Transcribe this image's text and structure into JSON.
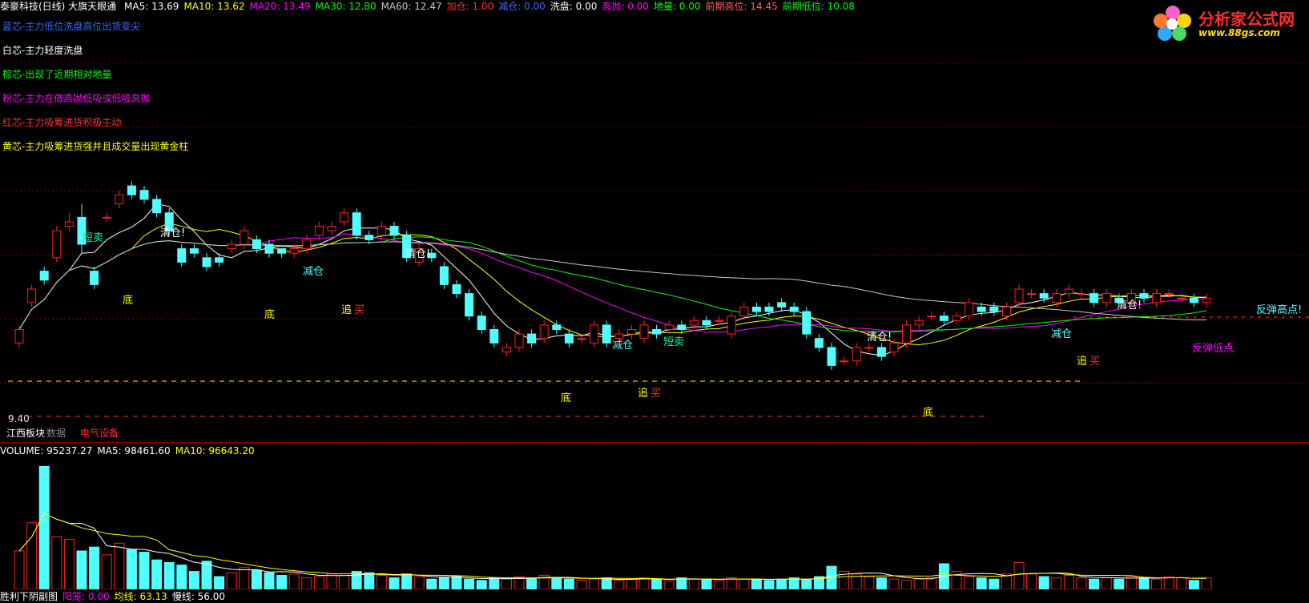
{
  "header": {
    "title": "泰豪科技(日线) 大旗天眼通",
    "items": [
      {
        "text": "MA5: 13.69",
        "color": "#ffffff"
      },
      {
        "text": "MA10: 13.62",
        "color": "#ffff00"
      },
      {
        "text": "MA20: 13.49",
        "color": "#ff00ff"
      },
      {
        "text": "MA30: 12.80",
        "color": "#00ff00"
      },
      {
        "text": "MA60: 12.47",
        "color": "#c8c8c8"
      },
      {
        "text": "加仓: 1.00",
        "color": "#ff3030"
      },
      {
        "text": "减仓: 0.00",
        "color": "#3a6cff"
      },
      {
        "text": "洗盘: 0.00",
        "color": "#ffffff"
      },
      {
        "text": "高抛: 0.00",
        "color": "#ff00ff"
      },
      {
        "text": "地量: 0.00",
        "color": "#00ff00"
      },
      {
        "text": "前期高位: 14.45",
        "color": "#ff6060"
      },
      {
        "text": "前期低位: 10.08",
        "color": "#00ff00"
      }
    ]
  },
  "legend": [
    {
      "text": "蓝芯-主力低位洗盘高位出货变尖",
      "color": "#3a6cff"
    },
    {
      "text": "白芯-主力轻度洗盘",
      "color": "#ffffff"
    },
    {
      "text": "棕芯-出现了近期相对地量",
      "color": "#00ff00"
    },
    {
      "text": "粉芯-主力在做高抛低吸或低吸高抛",
      "color": "#ff00ff"
    },
    {
      "text": "红芯-主力吸筹进货积极主动",
      "color": "#ff3030"
    },
    {
      "text": "黄芯-主力吸筹进货强并且成交量出现黄金柱",
      "color": "#ffff00"
    }
  ],
  "logo": {
    "brand": "分析家公式网",
    "url": "www.88gs.com"
  },
  "price_low_label": "9.40",
  "sector_labels": {
    "jiangxi": "江西板块",
    "data": "数据",
    "electric": "电气设备"
  },
  "signals": {
    "duanmai": "短卖",
    "qingcang": "清仓!",
    "jiancang": "减仓",
    "di": "底",
    "zhui": "追",
    "mai": "买",
    "fantan_high": "反弹高点!",
    "fantan_low": "反弹低点"
  },
  "volume_header": {
    "items": [
      {
        "text": "VOLUME: 95237.27",
        "color": "#ffffff"
      },
      {
        "text": "MA5: 98461.60",
        "color": "#ffffff"
      },
      {
        "text": "MA10: 96643.20",
        "color": "#ffff00"
      }
    ]
  },
  "bottom_bar": {
    "items": [
      {
        "text": "胜利下阴副图",
        "color": "#ffffff"
      },
      {
        "text": "阳笼: 0.00",
        "color": "#ff00ff"
      },
      {
        "text": "均线: 63.13",
        "color": "#ffff00"
      },
      {
        "text": "慢线: 56.00",
        "color": "#ffffff"
      }
    ]
  },
  "colors": {
    "up": "#ff2020",
    "down": "#50ffff",
    "ma5": "#ffffff",
    "ma10": "#ffff00",
    "ma20": "#ff00ff",
    "ma30": "#00ff00",
    "ma60": "#c8c8c8",
    "grid": "#8a0000"
  },
  "chart_data": {
    "type": "candlestick",
    "candles": [
      [
        11.0,
        11.3,
        11.4,
        10.9
      ],
      [
        11.9,
        12.2,
        12.3,
        11.8
      ],
      [
        12.6,
        12.4,
        12.7,
        12.3
      ],
      [
        12.9,
        13.5,
        13.6,
        12.8
      ],
      [
        13.6,
        13.7,
        13.9,
        13.5
      ],
      [
        13.8,
        13.2,
        14.1,
        13.0
      ],
      [
        12.6,
        12.3,
        12.7,
        12.2
      ],
      [
        13.8,
        13.8,
        13.9,
        13.7
      ],
      [
        14.1,
        14.3,
        14.4,
        14.0
      ],
      [
        14.5,
        14.3,
        14.6,
        14.2
      ],
      [
        14.4,
        14.2,
        14.5,
        14.1
      ],
      [
        14.2,
        13.9,
        14.3,
        13.8
      ],
      [
        13.9,
        13.5,
        14.0,
        13.4
      ],
      [
        13.1,
        12.8,
        13.2,
        12.7
      ],
      [
        13.1,
        13.0,
        13.2,
        12.9
      ],
      [
        12.9,
        12.7,
        13.0,
        12.6
      ],
      [
        12.9,
        12.8,
        13.0,
        12.7
      ],
      [
        13.1,
        13.2,
        13.3,
        13.0
      ],
      [
        13.2,
        13.5,
        13.6,
        13.1
      ],
      [
        13.3,
        13.1,
        13.4,
        13.0
      ],
      [
        13.2,
        13.0,
        13.3,
        12.9
      ],
      [
        13.1,
        13.0,
        13.1,
        12.9
      ],
      [
        13.0,
        13.1,
        13.2,
        12.9
      ],
      [
        13.1,
        13.3,
        13.4,
        13.0
      ],
      [
        13.4,
        13.6,
        13.7,
        13.3
      ],
      [
        13.5,
        13.6,
        13.7,
        13.4
      ],
      [
        13.7,
        13.9,
        14.0,
        13.6
      ],
      [
        13.9,
        13.4,
        14.0,
        13.3
      ],
      [
        13.4,
        13.3,
        13.5,
        13.2
      ],
      [
        13.4,
        13.6,
        13.7,
        13.3
      ],
      [
        13.6,
        13.4,
        13.7,
        13.3
      ],
      [
        13.4,
        12.9,
        13.5,
        12.8
      ],
      [
        12.8,
        13.1,
        13.2,
        12.7
      ],
      [
        13.0,
        12.9,
        13.1,
        12.8
      ],
      [
        12.7,
        12.3,
        12.8,
        12.2
      ],
      [
        12.3,
        12.1,
        12.4,
        12.0
      ],
      [
        12.1,
        11.6,
        12.2,
        11.5
      ],
      [
        11.6,
        11.3,
        11.7,
        11.2
      ],
      [
        11.3,
        11.0,
        11.4,
        10.9
      ],
      [
        10.8,
        10.9,
        11.0,
        10.7
      ],
      [
        10.9,
        11.2,
        11.3,
        10.8
      ],
      [
        11.2,
        11.0,
        11.3,
        10.9
      ],
      [
        11.1,
        11.4,
        11.5,
        11.0
      ],
      [
        11.4,
        11.3,
        11.5,
        11.2
      ],
      [
        11.2,
        11.0,
        11.3,
        10.9
      ],
      [
        11.1,
        11.1,
        11.2,
        11.0
      ],
      [
        11.0,
        11.4,
        11.5,
        10.9
      ],
      [
        11.4,
        11.0,
        11.5,
        10.9
      ],
      [
        11.1,
        11.2,
        11.3,
        11.0
      ],
      [
        11.2,
        11.3,
        11.4,
        11.1
      ],
      [
        11.1,
        11.4,
        11.5,
        11.0
      ],
      [
        11.3,
        11.2,
        11.4,
        11.1
      ],
      [
        11.3,
        11.4,
        11.5,
        11.2
      ],
      [
        11.4,
        11.3,
        11.5,
        11.2
      ],
      [
        11.4,
        11.5,
        11.6,
        11.3
      ],
      [
        11.5,
        11.4,
        11.6,
        11.3
      ],
      [
        11.5,
        11.5,
        11.6,
        11.4
      ],
      [
        11.2,
        11.6,
        11.7,
        11.1
      ],
      [
        11.6,
        11.8,
        11.9,
        11.5
      ],
      [
        11.8,
        11.7,
        11.9,
        11.6
      ],
      [
        11.8,
        11.7,
        11.9,
        11.6
      ],
      [
        11.9,
        11.8,
        12.0,
        11.7
      ],
      [
        11.8,
        11.7,
        11.9,
        11.6
      ],
      [
        11.7,
        11.2,
        11.8,
        11.1
      ],
      [
        11.1,
        10.9,
        11.2,
        10.8
      ],
      [
        10.9,
        10.5,
        11.0,
        10.4
      ],
      [
        10.6,
        10.6,
        10.7,
        10.5
      ],
      [
        10.6,
        10.9,
        11.0,
        10.5
      ],
      [
        10.9,
        10.9,
        11.0,
        10.8
      ],
      [
        10.9,
        10.7,
        11.0,
        10.6
      ],
      [
        10.8,
        11.0,
        11.1,
        10.7
      ],
      [
        11.0,
        11.4,
        11.5,
        10.9
      ],
      [
        11.4,
        11.5,
        11.6,
        11.3
      ],
      [
        11.6,
        11.6,
        11.7,
        11.5
      ],
      [
        11.6,
        11.5,
        11.7,
        11.4
      ],
      [
        11.5,
        11.6,
        11.7,
        11.4
      ],
      [
        11.6,
        11.9,
        12.0,
        11.5
      ],
      [
        11.8,
        11.7,
        11.9,
        11.6
      ],
      [
        11.8,
        11.7,
        11.9,
        11.6
      ],
      [
        11.6,
        11.8,
        11.9,
        11.5
      ],
      [
        11.9,
        12.2,
        12.3,
        11.8
      ],
      [
        12.1,
        12.1,
        12.2,
        12.0
      ],
      [
        12.1,
        12.0,
        12.2,
        11.9
      ],
      [
        11.9,
        12.1,
        12.2,
        11.8
      ],
      [
        12.1,
        12.2,
        12.3,
        12.0
      ],
      [
        12.1,
        12.1,
        12.2,
        12.0
      ],
      [
        12.1,
        11.9,
        12.2,
        11.8
      ],
      [
        11.9,
        12.1,
        12.2,
        11.8
      ],
      [
        12.0,
        11.9,
        12.1,
        11.8
      ],
      [
        11.9,
        12.1,
        12.2,
        11.8
      ],
      [
        12.1,
        12.0,
        12.2,
        11.9
      ],
      [
        11.9,
        12.1,
        12.2,
        11.8
      ],
      [
        12.1,
        12.1,
        12.2,
        12.0
      ],
      [
        12.0,
        12.0,
        12.1,
        11.9
      ],
      [
        12.0,
        11.9,
        12.1,
        11.8
      ],
      [
        11.9,
        12.0,
        12.1,
        11.8
      ]
    ],
    "volumes": [
      30,
      52,
      96,
      41,
      39,
      30,
      33,
      27,
      36,
      31,
      29,
      23,
      21,
      19,
      14,
      22,
      10,
      13,
      17,
      15,
      13,
      11,
      12,
      9,
      10,
      12,
      11,
      14,
      13,
      11,
      9,
      12,
      10,
      8,
      9,
      10,
      8,
      7,
      9,
      8,
      10,
      9,
      11,
      9,
      8,
      7,
      8,
      9,
      7,
      8,
      9,
      8,
      7,
      9,
      8,
      8,
      7,
      9,
      8,
      8,
      7,
      8,
      9,
      8,
      10,
      18,
      14,
      12,
      10,
      9,
      8,
      7,
      8,
      9,
      20,
      14,
      10,
      9,
      8,
      12,
      21,
      12,
      10,
      9,
      11,
      9,
      8,
      9,
      8,
      10,
      9,
      8,
      10,
      9,
      7,
      9
    ]
  }
}
